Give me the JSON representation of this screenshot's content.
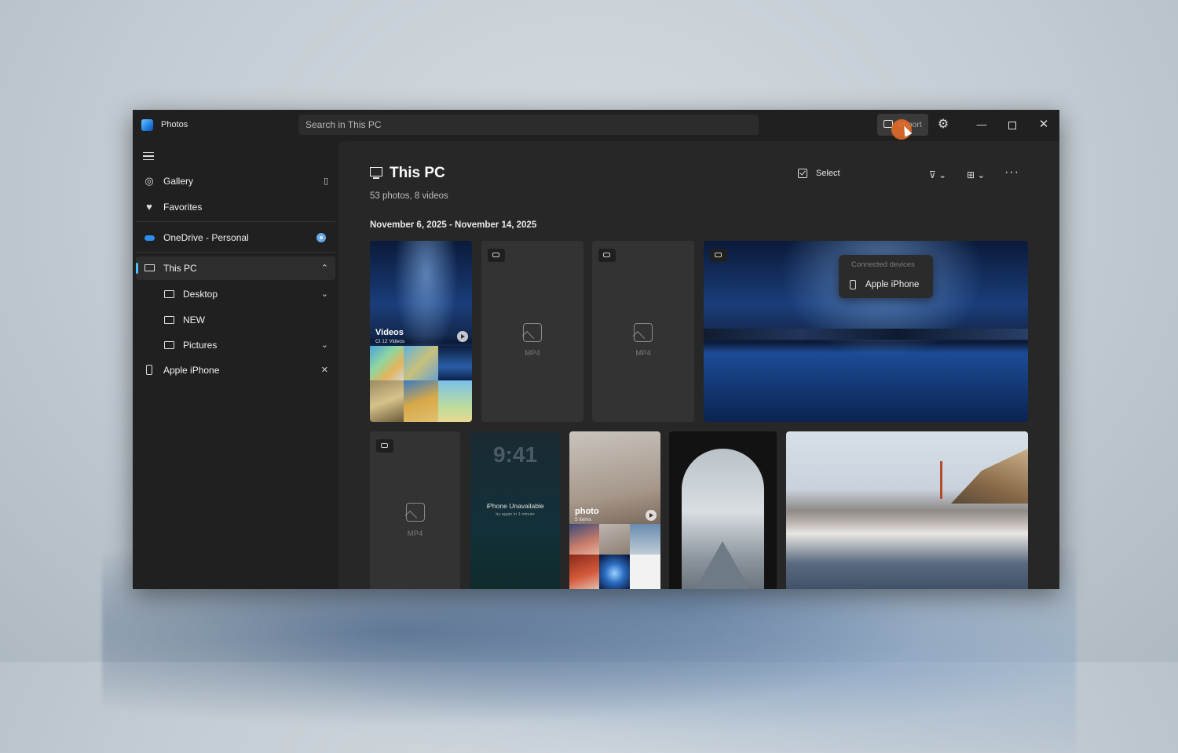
{
  "app": {
    "title": "Photos"
  },
  "search": {
    "placeholder": "Search in This PC"
  },
  "titlebar": {
    "import_label": "Import"
  },
  "sidebar": {
    "gallery": "Gallery",
    "favorites": "Favorites",
    "onedrive": "OneDrive - Personal",
    "this_pc": "This PC",
    "desktop": "Desktop",
    "new": "NEW",
    "pictures": "Pictures",
    "apple_iphone": "Apple iPhone"
  },
  "main": {
    "title": "This PC",
    "subtitle": "53 photos, 8 videos",
    "date_range": "November 6, 2025 - November 14, 2025",
    "select_label": "Select"
  },
  "devices_popup": {
    "header": "Connected devices",
    "items": [
      {
        "label": "Apple iPhone"
      }
    ]
  },
  "tiles": {
    "videos_album": {
      "label": "Videos",
      "sub": "Ct 12 Videos"
    },
    "photo_album": {
      "label": "photo",
      "sub": "5 items"
    },
    "mp4_label": "MP4",
    "lock_screen": {
      "time": "9:41",
      "message": "iPhone Unavailable",
      "detail": "try again in 1 minute"
    }
  },
  "colors": {
    "accent": "#4cc2ff",
    "window_bg": "#202020",
    "content_bg": "#272727"
  },
  "icons": {
    "app": "photos-app-icon",
    "import": "import-icon",
    "settings": "gear-icon",
    "gallery": "gallery-icon",
    "favorites": "heart-icon",
    "onedrive": "cloud-icon",
    "this_pc": "computer-icon",
    "folder": "folder-icon",
    "phone": "phone-icon",
    "filter": "filter-icon",
    "view": "grid-view-icon",
    "more": "more-icon"
  }
}
